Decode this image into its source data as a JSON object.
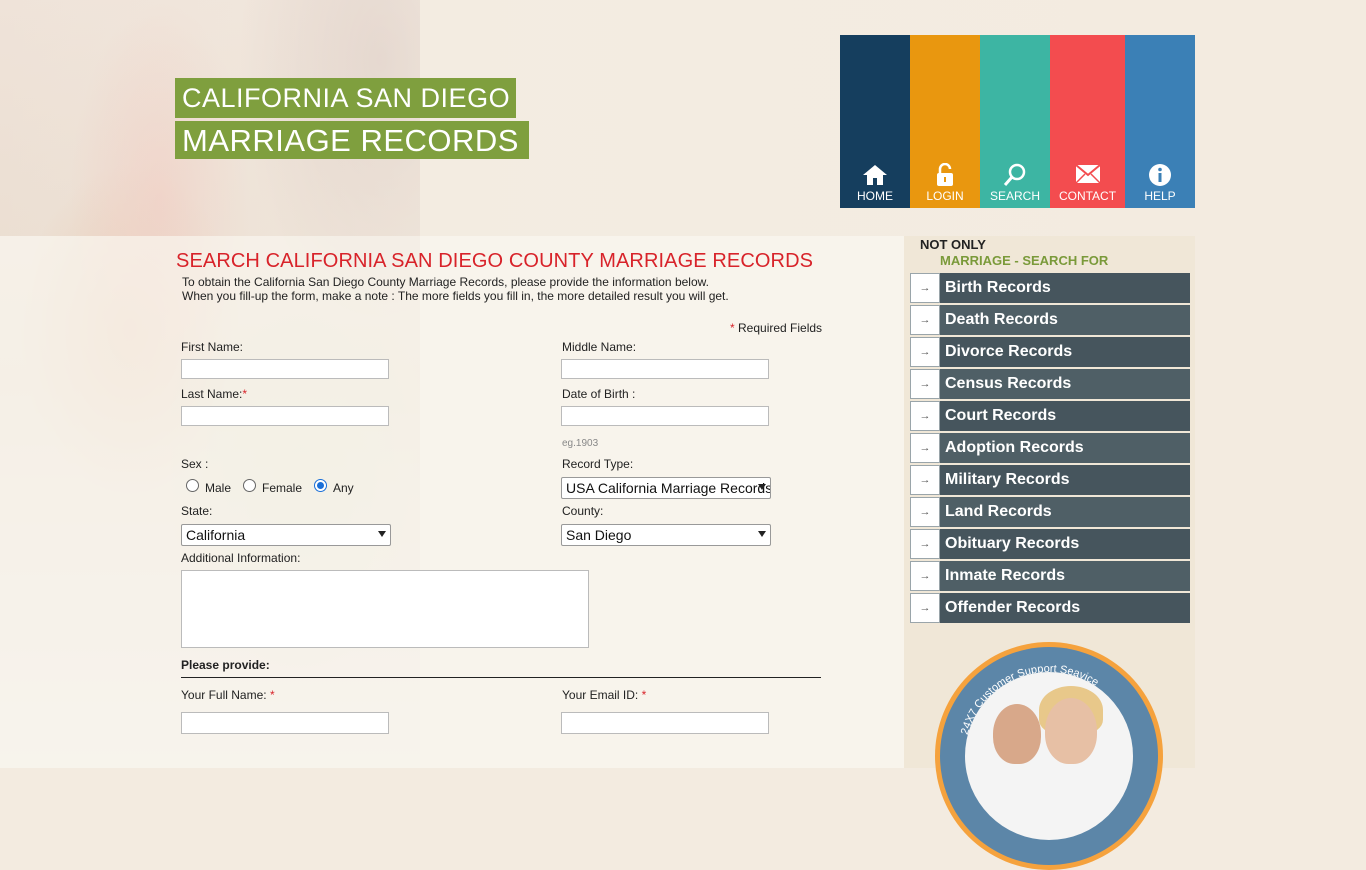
{
  "header": {
    "title_line1": "CALIFORNIA SAN DIEGO",
    "title_line2": "MARRIAGE RECORDS"
  },
  "nav": {
    "items": [
      {
        "label": "HOME",
        "icon": "home-icon",
        "color": "#153e5e"
      },
      {
        "label": "LOGIN",
        "icon": "lock-icon",
        "color": "#e9970f"
      },
      {
        "label": "SEARCH",
        "icon": "search-icon",
        "color": "#3db5a3"
      },
      {
        "label": "CONTACT",
        "icon": "mail-icon",
        "color": "#f34c4f"
      },
      {
        "label": "HELP",
        "icon": "info-icon",
        "color": "#3b80b6"
      }
    ]
  },
  "main": {
    "heading": "SEARCH CALIFORNIA SAN DIEGO COUNTY MARRIAGE RECORDS",
    "intro_line1": "To obtain the California San Diego County Marriage Records, please provide the information below.",
    "intro_line2": "When you fill-up the form, make a note : The more fields you fill in, the more detailed result you will get.",
    "required_note": "Required Fields",
    "required_star": "*"
  },
  "form": {
    "first_name_label": "First Name:",
    "middle_name_label": "Middle Name:",
    "last_name_label": "Last Name:",
    "dob_label": "Date of Birth :",
    "dob_hint": "eg.1903",
    "sex_label": "Sex :",
    "sex_options": [
      "Male",
      "Female",
      "Any"
    ],
    "sex_selected": "Any",
    "record_type_label": "Record Type:",
    "record_type_value": "USA California Marriage Records",
    "state_label": "State:",
    "state_value": "California",
    "county_label": "County:",
    "county_value": "San Diego",
    "additional_label": "Additional Information:",
    "please_provide": "Please provide:",
    "full_name_label": "Your Full Name:",
    "email_label": "Your Email ID:"
  },
  "sidebar": {
    "title_line1": "NOT ONLY",
    "title_line2": "MARRIAGE - SEARCH FOR",
    "records": [
      "Birth Records",
      "Death Records",
      "Divorce Records",
      "Census Records",
      "Court Records",
      "Adoption Records",
      "Military Records",
      "Land Records",
      "Obituary Records",
      "Inmate Records",
      "Offender Records"
    ],
    "support_text": "24X7 Customer Support Seavice"
  },
  "colors": {
    "accent_red": "#d8232a",
    "title_green": "#7f9f3e",
    "sidebar_green": "#7a9a3a",
    "record_bar": "#4f5f66"
  }
}
